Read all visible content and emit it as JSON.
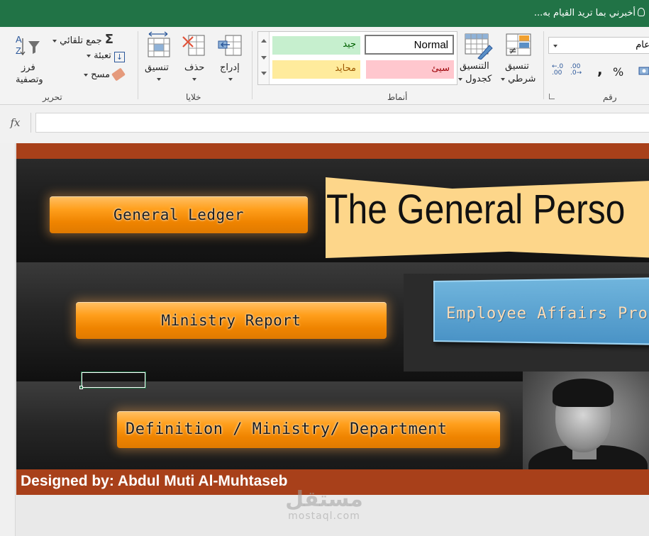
{
  "app": {
    "tell_me": "أخبرني بما تريد القيام به..."
  },
  "ribbon": {
    "editing": {
      "group_label": "تحرير",
      "autosum": "جمع تلقائي",
      "fill": "تعبئة",
      "clear": "مسح",
      "sort_filter_line1": "فرز",
      "sort_filter_line2": "وتصفية"
    },
    "cells": {
      "group_label": "خلايا",
      "format": "تنسيق",
      "delete": "حذف",
      "insert": "إدراج"
    },
    "styles": {
      "group_label": "أنماط",
      "gallery": {
        "normal": "Normal",
        "good": "جيد",
        "bad": "سيئ",
        "neutral": "محايد"
      },
      "format_as_table_line1": "التنسيق",
      "format_as_table_line2": "كجدول",
      "conditional_line1": "تنسيق",
      "conditional_line2": "شرطي"
    },
    "number": {
      "group_label": "رقم",
      "format_value": "عام",
      "comma": ",",
      "percent": "%"
    }
  },
  "formula_bar": {
    "fx": "fx",
    "value": ""
  },
  "dashboard": {
    "buttons": {
      "general_ledger": "General Ledger",
      "ministry_report": "Ministry Report",
      "definition": "Definition / Ministry/ Department"
    },
    "banner_title": "The General Perso",
    "sign_title": "Employee Affairs Prog",
    "designed_by": "Designed by: Abdul Muti Al-Muhtaseb"
  },
  "watermark": {
    "ar": "مستقل",
    "en": "mostaql.com"
  },
  "colors": {
    "title_bar": "#217346",
    "accent_band": "#a8401a",
    "button_orange": "#ff9f1c",
    "banner": "#fdd68a",
    "sign_blue": "#5aa3d2",
    "style_good_bg": "#c6efce",
    "style_good_fg": "#006100",
    "style_bad_bg": "#ffc7ce",
    "style_bad_fg": "#9c0006",
    "style_neutral_bg": "#ffeb9c",
    "style_neutral_fg": "#9c5700"
  }
}
